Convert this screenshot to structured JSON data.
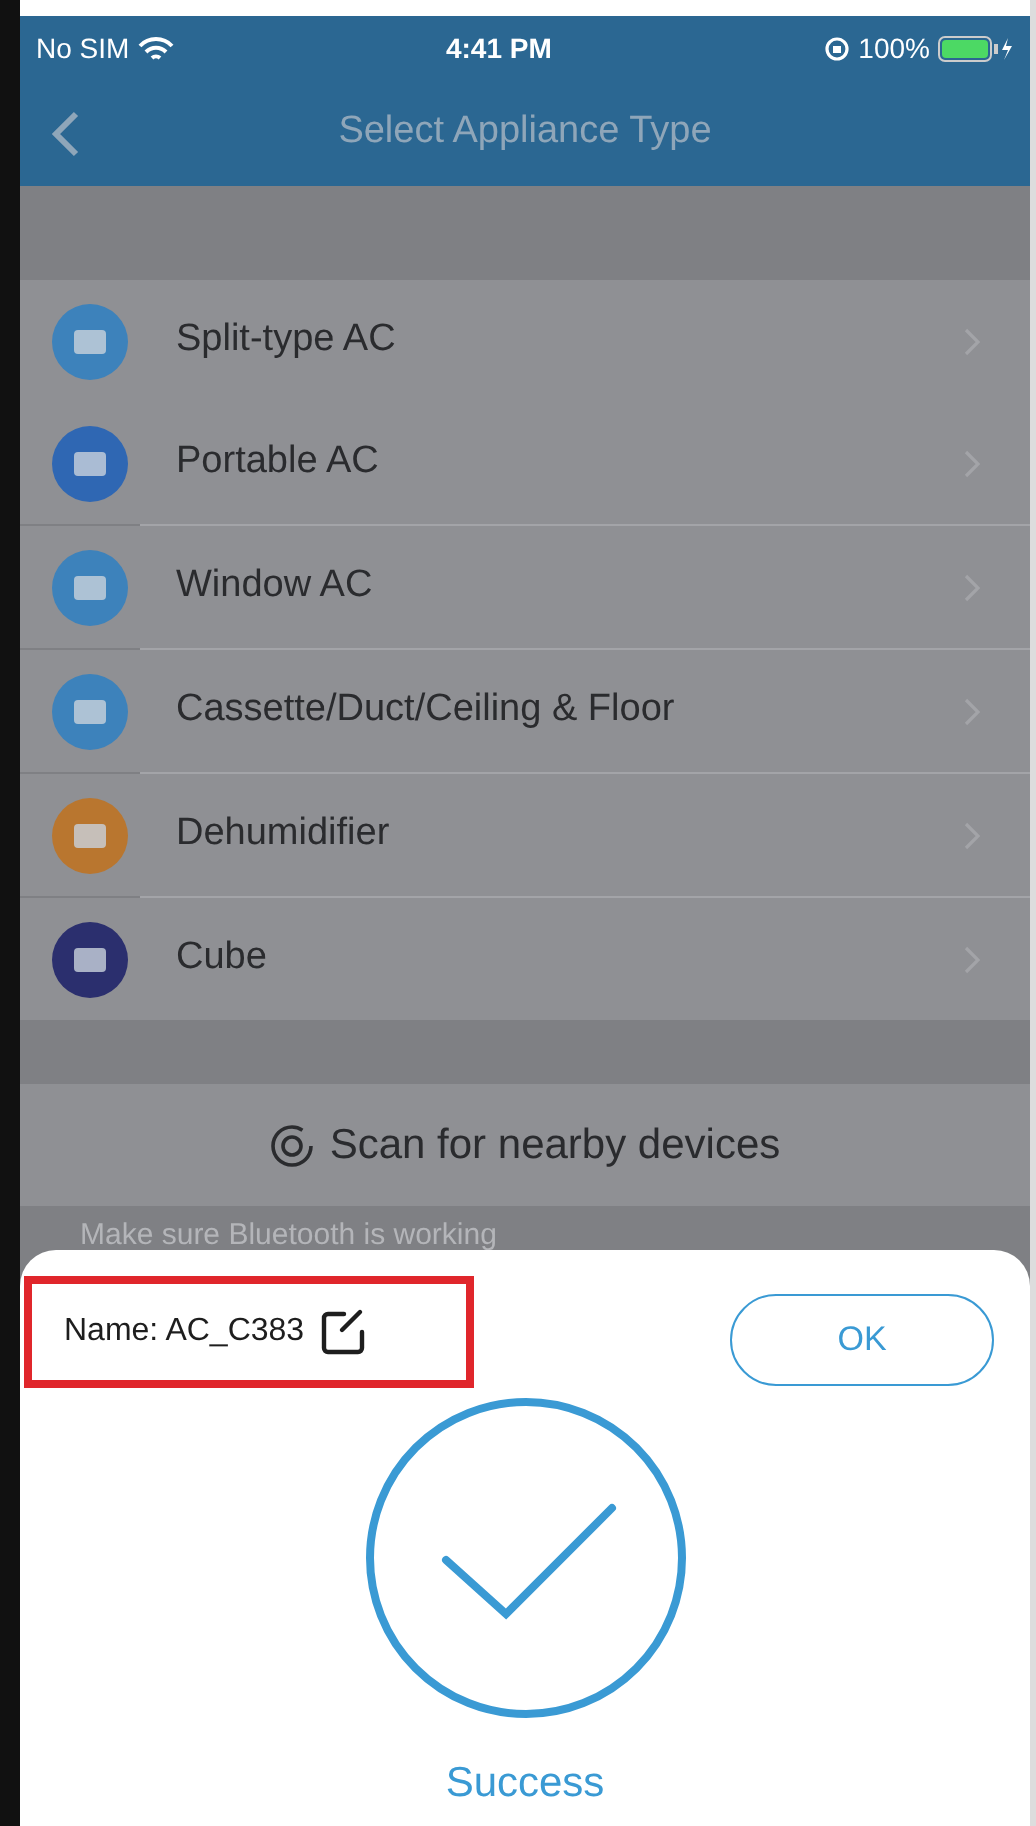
{
  "status_bar": {
    "carrier": "No SIM",
    "time": "4:41 PM",
    "battery": "100%"
  },
  "nav": {
    "title": "Select Appliance Type"
  },
  "appliances": [
    {
      "label": "Split-type AC",
      "color": "#3d82bb"
    },
    {
      "label": "Portable AC",
      "color": "#2f67b3"
    },
    {
      "label": "Window AC",
      "color": "#3d82bb"
    },
    {
      "label": "Cassette/Duct/Ceiling & Floor",
      "color": "#3d82bb"
    },
    {
      "label": "Dehumidifier",
      "color": "#b9762f"
    },
    {
      "label": "Cube",
      "color": "#2b2f6e"
    }
  ],
  "scan": {
    "label": "Scan for nearby devices"
  },
  "hint": "Make sure Bluetooth is working",
  "dialog": {
    "name": "Name: AC_C383",
    "ok": "OK",
    "status": "Success"
  }
}
